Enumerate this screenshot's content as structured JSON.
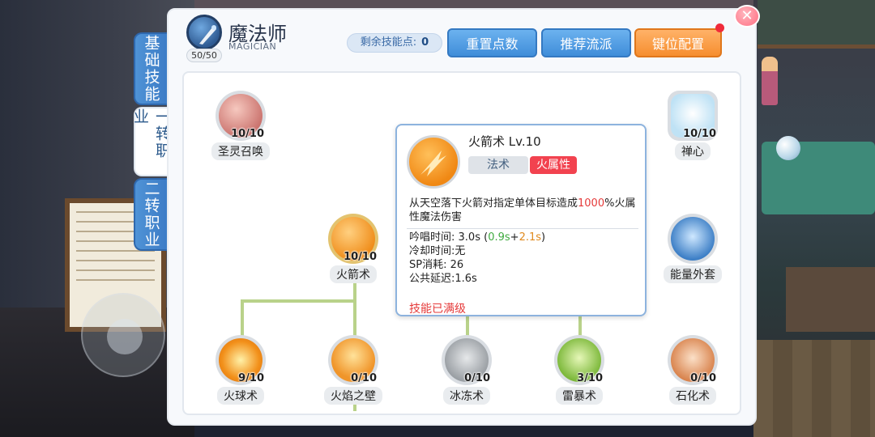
{
  "tabs": [
    {
      "label": "基础技能"
    },
    {
      "label": "一转职业"
    },
    {
      "label": "二转职业"
    }
  ],
  "header": {
    "class_name": "魔法师",
    "class_sub": "MAGICIAN",
    "level": "50/50",
    "points_label": "剩余技能点:",
    "points_value": "0",
    "buttons": {
      "reset": "重置点数",
      "recommend": "推荐流派",
      "keys": "键位配置"
    },
    "close_icon": "close-icon"
  },
  "skills": [
    {
      "name": "圣灵召唤",
      "level": "10/10",
      "icon": "summon-icon",
      "color": "#e8a59b"
    },
    {
      "name": "禅心",
      "level": "10/10",
      "icon": "meditation-icon",
      "color": "#a9d6ef"
    },
    {
      "name": "火箭术",
      "level": "10/10",
      "icon": "fire-bolt-icon",
      "color": "#f2982a"
    },
    {
      "name": "能量外套",
      "level": "",
      "icon": "energy-coat-icon",
      "color": "#5e9bd3"
    },
    {
      "name": "火球术",
      "level": "9/10",
      "icon": "fire-ball-icon",
      "color": "#f5941f"
    },
    {
      "name": "火焰之壁",
      "level": "0/10",
      "icon": "fire-wall-icon",
      "color": "#f39a2c"
    },
    {
      "name": "冰冻术",
      "level": "0/10",
      "icon": "frost-icon",
      "color": "#a9adb2"
    },
    {
      "name": "雷暴术",
      "level": "3/10",
      "icon": "thunder-icon",
      "color": "#8bc24a"
    },
    {
      "name": "石化术",
      "level": "0/10",
      "icon": "stone-curse-icon",
      "color": "#e8a57a"
    }
  ],
  "tooltip": {
    "title": "火箭术 Lv.10",
    "tag_type": "法术",
    "tag_element": "火属性",
    "desc_pre": "从天空落下火箭对指定单体目标造成",
    "desc_value": "1000",
    "desc_post": "%火属性魔法伤害",
    "cast_label": "吟唱时间:",
    "cast_value": "3.0s",
    "cast_open": "(",
    "cast_green": "0.9s",
    "cast_plus": "+",
    "cast_orange": "2.1s",
    "cast_close": ")",
    "cooldown": "冷却时间:无",
    "sp": "SP消耗: 26",
    "delay": "公共延迟:1.6s",
    "maxed": "技能已满级"
  },
  "colors": {
    "accent_blue": "#3f8dd9",
    "accent_orange": "#f68e2f",
    "line": "#b9d28a",
    "red": "#e53a3a"
  }
}
